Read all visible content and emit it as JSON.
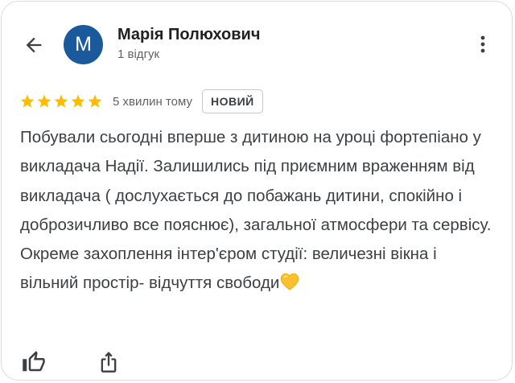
{
  "author": {
    "name": "Марія Полюхович",
    "avatar_letter": "M",
    "review_count": "1 відгук"
  },
  "review": {
    "rating": 5,
    "max_rating": 5,
    "time_ago": "5 хвилин тому",
    "badge": "НОВИЙ",
    "text": "Побували сьогодні вперше з дитиною на уроці фортепіано у викладача Надії. Залишились під приємним враженням від викладача ( дослухається до побажань дитини, спокійно і доброзичливо все пояснює), загальної атмосфери та сервісу. Окреме захоплення інтер'єром студії: величезні вікна і вільний простір- відчуття свободи",
    "trailing_emoji": "yellow-heart-emoji"
  },
  "icons": {
    "back": "arrow-back-icon",
    "more": "more-vert-icon",
    "like": "thumb-up-icon",
    "share": "share-icon"
  },
  "colors": {
    "avatar_bg": "#1a5a9c",
    "star": "#fbbc04",
    "heart": "#fbc02d",
    "text": "#3c4043",
    "secondary_text": "#5f6368",
    "border": "#dadce0"
  }
}
